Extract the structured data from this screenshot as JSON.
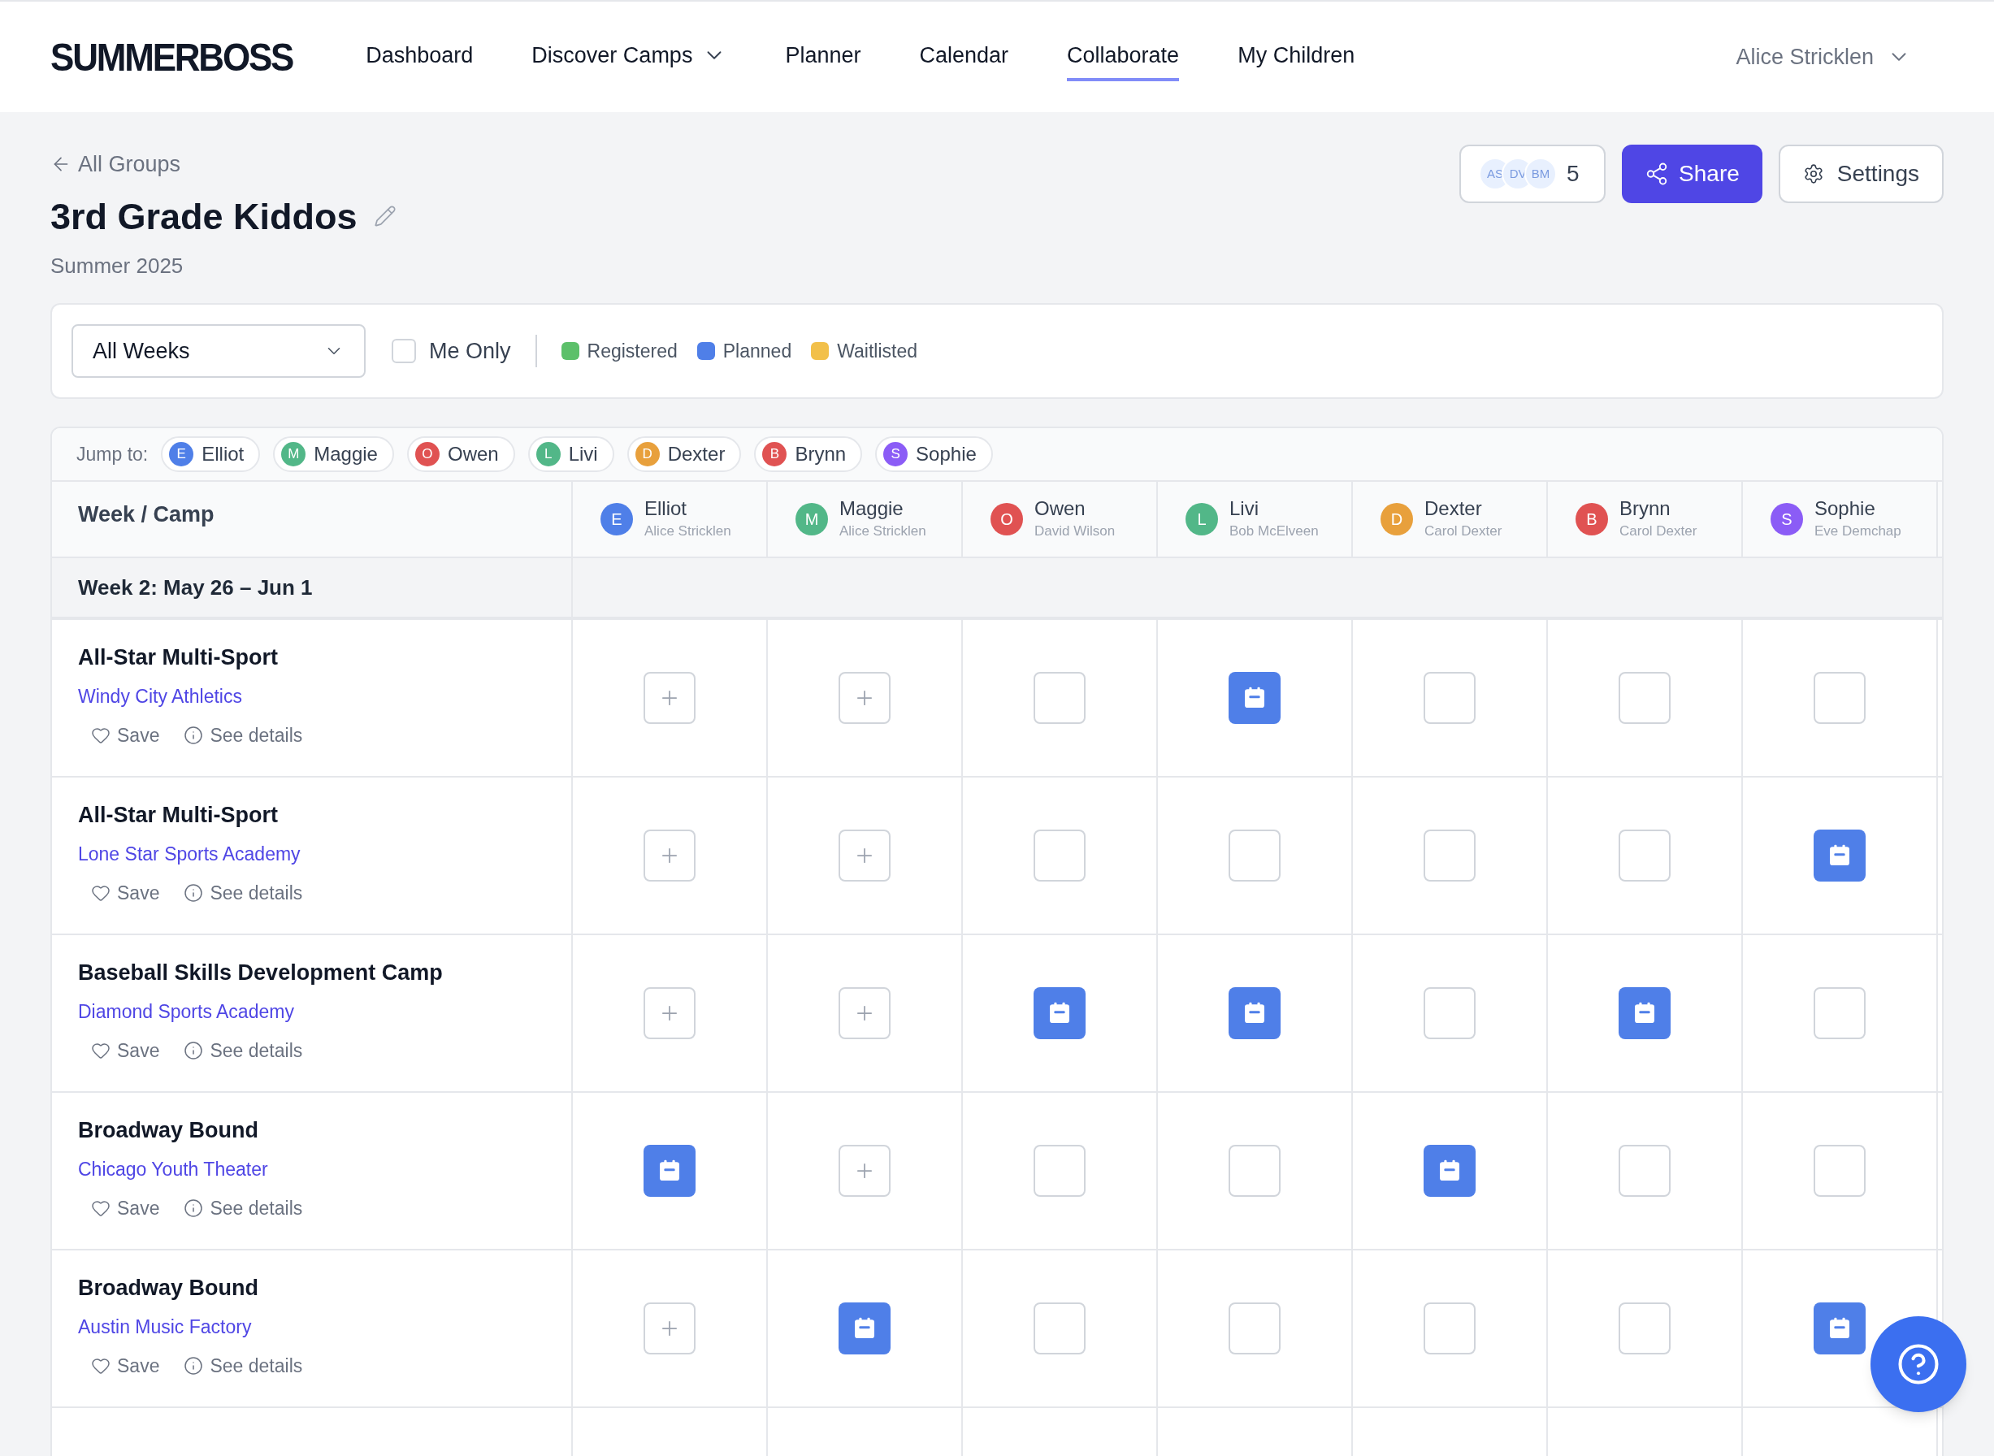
{
  "nav": {
    "logo": "SUMMERBOSS",
    "items": [
      {
        "label": "Dashboard",
        "selected": false,
        "dropdown": false
      },
      {
        "label": "Discover Camps",
        "selected": false,
        "dropdown": true
      },
      {
        "label": "Planner",
        "selected": false,
        "dropdown": false
      },
      {
        "label": "Calendar",
        "selected": false,
        "dropdown": false
      },
      {
        "label": "Collaborate",
        "selected": true,
        "dropdown": false
      },
      {
        "label": "My Children",
        "selected": false,
        "dropdown": false
      }
    ],
    "user": "Alice Stricklen"
  },
  "group": {
    "back": "All Groups",
    "title": "3rd Grade Kiddos",
    "season": "Summer 2025",
    "members": {
      "avatars": [
        "AS",
        "DV",
        "BM"
      ],
      "count": "5"
    },
    "share": "Share",
    "settings": "Settings"
  },
  "filters": {
    "week_select": "All Weeks",
    "me_only": {
      "label": "Me Only",
      "checked": false
    },
    "legend": [
      {
        "label": "Registered",
        "color": "#5cc06a"
      },
      {
        "label": "Planned",
        "color": "#4f7fe8"
      },
      {
        "label": "Waitlisted",
        "color": "#f2c04a"
      }
    ]
  },
  "jump_to": {
    "label": "Jump to:",
    "children": [
      {
        "initial": "E",
        "name": "Elliot",
        "color": "#4f7fe8"
      },
      {
        "initial": "M",
        "name": "Maggie",
        "color": "#52b788"
      },
      {
        "initial": "O",
        "name": "Owen",
        "color": "#e05252"
      },
      {
        "initial": "L",
        "name": "Livi",
        "color": "#52b788"
      },
      {
        "initial": "D",
        "name": "Dexter",
        "color": "#e8a03c"
      },
      {
        "initial": "B",
        "name": "Brynn",
        "color": "#e05252"
      },
      {
        "initial": "S",
        "name": "Sophie",
        "color": "#8b5cf6"
      }
    ]
  },
  "table": {
    "first_column": "Week / Camp",
    "columns": [
      {
        "initial": "E",
        "name": "Elliot",
        "parent": "Alice Stricklen",
        "color": "#4f7fe8"
      },
      {
        "initial": "M",
        "name": "Maggie",
        "parent": "Alice Stricklen",
        "color": "#52b788"
      },
      {
        "initial": "O",
        "name": "Owen",
        "parent": "David Wilson",
        "color": "#e05252"
      },
      {
        "initial": "L",
        "name": "Livi",
        "parent": "Bob McElveen",
        "color": "#52b788"
      },
      {
        "initial": "D",
        "name": "Dexter",
        "parent": "Carol Dexter",
        "color": "#e8a03c"
      },
      {
        "initial": "B",
        "name": "Brynn",
        "parent": "Carol Dexter",
        "color": "#e05252"
      },
      {
        "initial": "S",
        "name": "Sophie",
        "parent": "Eve Demchap",
        "color": "#8b5cf6"
      }
    ],
    "week": "Week 2: May 26 – Jun 1",
    "camps": [
      {
        "title": "All-Star Multi-Sport",
        "org": "Windy City Athletics",
        "save": "Save",
        "details": "See details",
        "cells": [
          {
            "kind": "add"
          },
          {
            "kind": "add"
          },
          {
            "kind": "empty"
          },
          {
            "kind": "planned"
          },
          {
            "kind": "empty"
          },
          {
            "kind": "empty"
          },
          {
            "kind": "empty"
          }
        ]
      },
      {
        "title": "All-Star Multi-Sport",
        "org": "Lone Star Sports Academy",
        "save": "Save",
        "details": "See details",
        "cells": [
          {
            "kind": "add"
          },
          {
            "kind": "add"
          },
          {
            "kind": "empty"
          },
          {
            "kind": "empty"
          },
          {
            "kind": "empty"
          },
          {
            "kind": "empty"
          },
          {
            "kind": "planned"
          }
        ]
      },
      {
        "title": "Baseball Skills Development Camp",
        "org": "Diamond Sports Academy",
        "save": "Save",
        "details": "See details",
        "cells": [
          {
            "kind": "add"
          },
          {
            "kind": "add"
          },
          {
            "kind": "planned"
          },
          {
            "kind": "planned"
          },
          {
            "kind": "empty"
          },
          {
            "kind": "planned"
          },
          {
            "kind": "empty"
          }
        ]
      },
      {
        "title": "Broadway Bound",
        "org": "Chicago Youth Theater",
        "save": "Save",
        "details": "See details",
        "cells": [
          {
            "kind": "planned"
          },
          {
            "kind": "add"
          },
          {
            "kind": "empty"
          },
          {
            "kind": "empty"
          },
          {
            "kind": "planned"
          },
          {
            "kind": "empty"
          },
          {
            "kind": "empty"
          }
        ]
      },
      {
        "title": "Broadway Bound",
        "org": "Austin Music Factory",
        "save": "Save",
        "details": "See details",
        "cells": [
          {
            "kind": "add"
          },
          {
            "kind": "planned"
          },
          {
            "kind": "empty"
          },
          {
            "kind": "empty"
          },
          {
            "kind": "empty"
          },
          {
            "kind": "empty"
          },
          {
            "kind": "planned"
          }
        ]
      }
    ]
  }
}
